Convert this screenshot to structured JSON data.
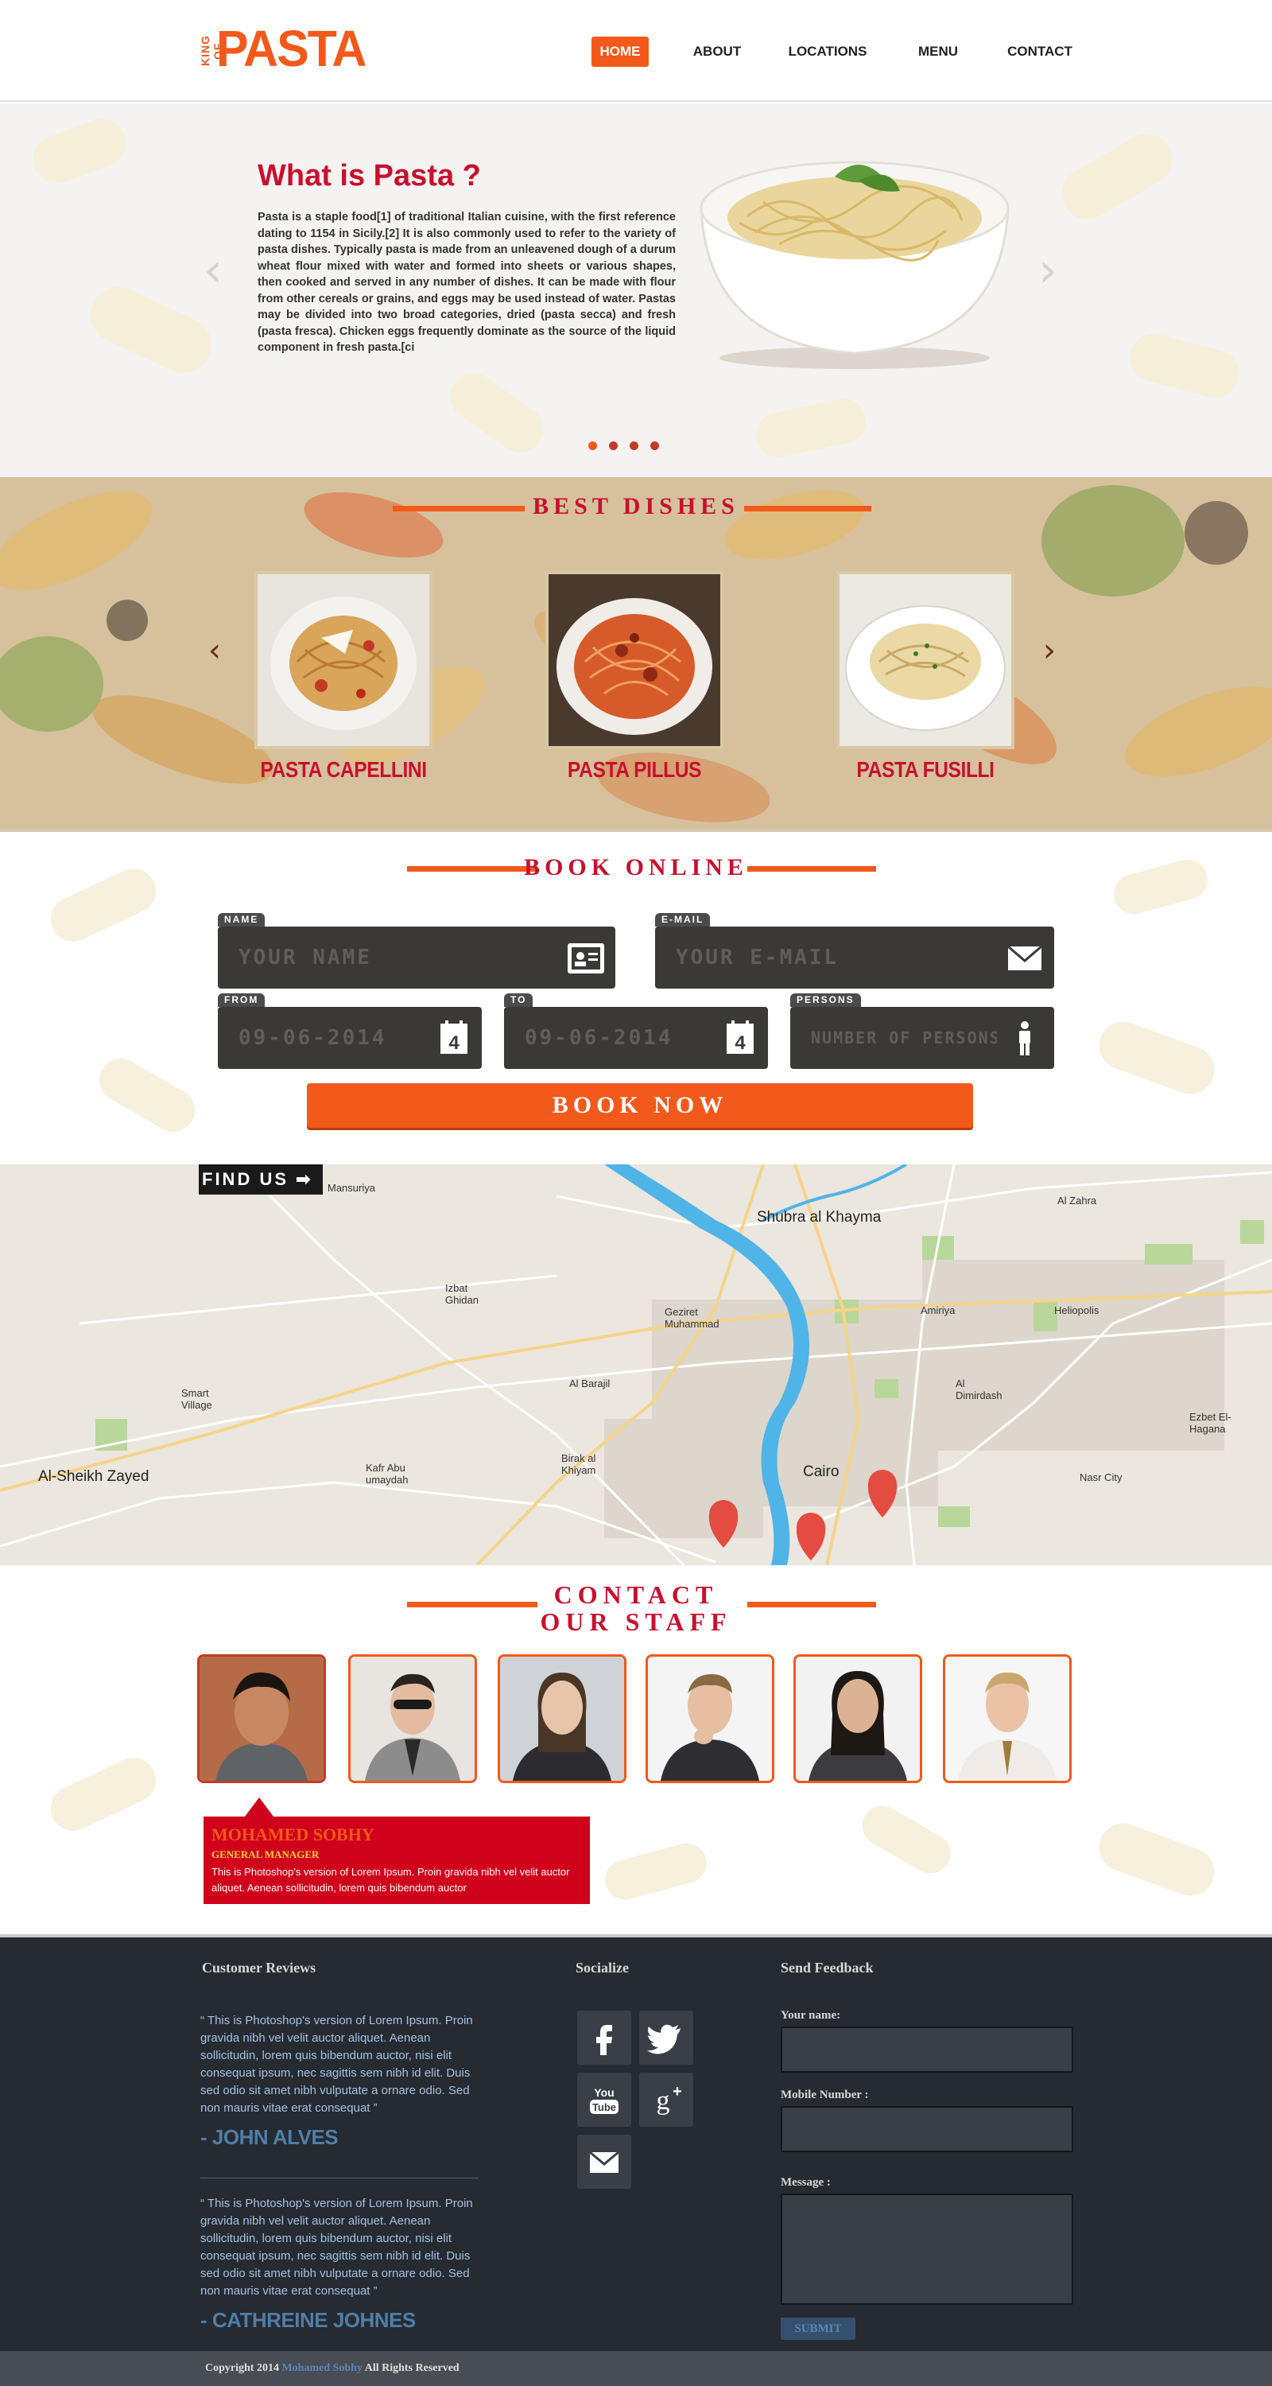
{
  "header": {
    "logo_small": "KING OF",
    "logo_big": "PASTA",
    "nav": [
      {
        "label": "HOME",
        "active": true
      },
      {
        "label": "ABOUT",
        "active": false
      },
      {
        "label": "LOCATIONS",
        "active": false
      },
      {
        "label": "MENU",
        "active": false
      },
      {
        "label": "CONTACT",
        "active": false
      }
    ]
  },
  "hero": {
    "title": "What is Pasta ?",
    "text": "Pasta is a staple food[1] of traditional Italian cuisine, with the first reference dating to 1154 in Sicily.[2] It is also commonly used to refer to the variety of pasta dishes. Typically pasta is made from an unleavened dough of a durum wheat flour mixed with water and formed into sheets or various shapes, then cooked and served in any number of dishes. It can be made with flour from other cereals or grains, and eggs may be used instead of water. Pastas may be divided into two broad categories, dried (pasta secca) and fresh (pasta fresca). Chicken eggs frequently dominate as the source of the liquid component in fresh pasta.[ci",
    "prev_icon": "chevron-left-icon",
    "next_icon": "chevron-right-icon",
    "slide_count": 4,
    "active_slide": 1
  },
  "dishes": {
    "title": "BEST DISHES",
    "items": [
      {
        "name": "PASTA CAPELLINI"
      },
      {
        "name": "PASTA PILLUS"
      },
      {
        "name": "PASTA FUSILLI"
      }
    ]
  },
  "booking": {
    "title": "BOOK ONLINE",
    "name_label": "NAME",
    "name_placeholder": "YOUR NAME",
    "email_label": "E-MAIL",
    "email_placeholder": "YOUR E-MAIL",
    "from_label": "FROM",
    "from_placeholder": "09-06-2014",
    "to_label": "TO",
    "to_placeholder": "09-06-2014",
    "persons_label": "PERSONS",
    "persons_placeholder": "NUMBER OF PERSONS",
    "calendar_day": "4",
    "button": "BOOK NOW"
  },
  "map": {
    "find_us": "FIND US",
    "labels": [
      "Mansuriya",
      "Shubra al Khayma",
      "Al Zahra",
      "Geziret Muhammad",
      "Izbat Ghidan",
      "Heliopolis",
      "Amiriya",
      "Smart Village",
      "Al Barajil",
      "Al Dimirdash",
      "Ezbet El-Hagana",
      "Al-Sheikh Zayed",
      "Kafr Abu umaydah",
      "Birak al Khiyam",
      "Cairo",
      "Nasr City"
    ]
  },
  "staff": {
    "title_line1": "CONTACT",
    "title_line2": "OUR STAFF",
    "selected": {
      "name": "MOHAMED SOBHY",
      "role": "GENERAL MANAGER",
      "bio": "This is Photoshop's version of Lorem Ipsum. Proin gravida nibh vel velit auctor aliquet. Aenean sollicitudin, lorem quis bibendum auctor"
    }
  },
  "footer": {
    "reviews_title": "Customer Reviews",
    "reviews": [
      {
        "quote": "This is Photoshop's version of Lorem Ipsum. Proin gravida nibh vel velit auctor aliquet. Aenean sollicitudin, lorem quis bibendum auctor, nisi elit consequat ipsum, nec sagittis sem nibh id elit. Duis sed odio sit amet nibh vulputate a ornare odio. Sed non mauris vitae erat consequat",
        "author": "- JOHN ALVES"
      },
      {
        "quote": "This is Photoshop's version of Lorem Ipsum. Proin gravida nibh vel velit auctor aliquet. Aenean sollicitudin, lorem quis bibendum auctor, nisi elit consequat ipsum, nec sagittis sem nibh id elit. Duis sed odio sit amet nibh vulputate a ornare odio. Sed non mauris vitae erat consequat",
        "author": "- CATHREINE JOHNES"
      }
    ],
    "socialize_title": "Socialize",
    "social_icons": [
      "facebook-icon",
      "twitter-icon",
      "youtube-icon",
      "google-plus-icon",
      "email-icon"
    ],
    "feedback_title": "Send Feedback",
    "name_label": "Your name:",
    "mobile_label": "Mobile Number :",
    "message_label": "Message :",
    "submit": "SUBMIT",
    "copyright_prefix": "Copyright 2014",
    "copyright_author": "Mohamed Sobhy",
    "copyright_suffix": "All Rights Reserved"
  },
  "colors": {
    "accent": "#f2591a",
    "title_red": "#c8102e",
    "footer_bg": "#262a31",
    "field_bg": "#3a3938"
  }
}
